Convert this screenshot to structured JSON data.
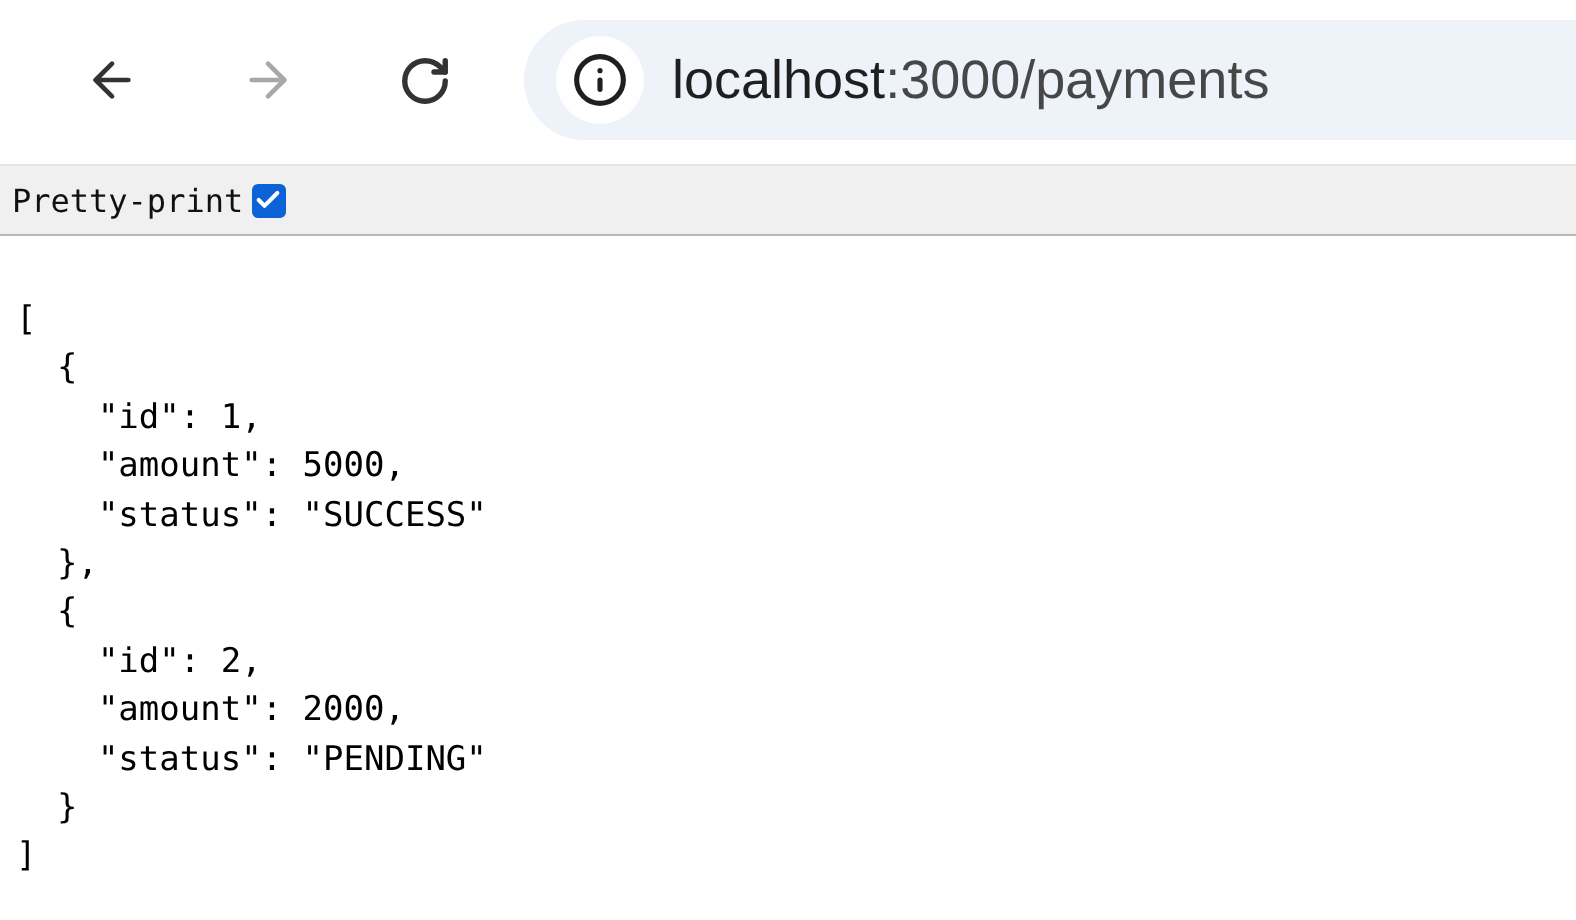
{
  "toolbar": {
    "back": {
      "disabled": false
    },
    "forward": {
      "disabled": true
    },
    "address": {
      "host": "localhost",
      "path": ":3000/payments"
    }
  },
  "pretty_print": {
    "label": "Pretty-print",
    "checked": true
  },
  "body_lines": [
    "[",
    "  {",
    "    \"id\": 1,",
    "    \"amount\": 5000,",
    "    \"status\": \"SUCCESS\"",
    "  },",
    "  {",
    "    \"id\": 2,",
    "    \"amount\": 2000,",
    "    \"status\": \"PENDING\"",
    "  }",
    "]"
  ]
}
